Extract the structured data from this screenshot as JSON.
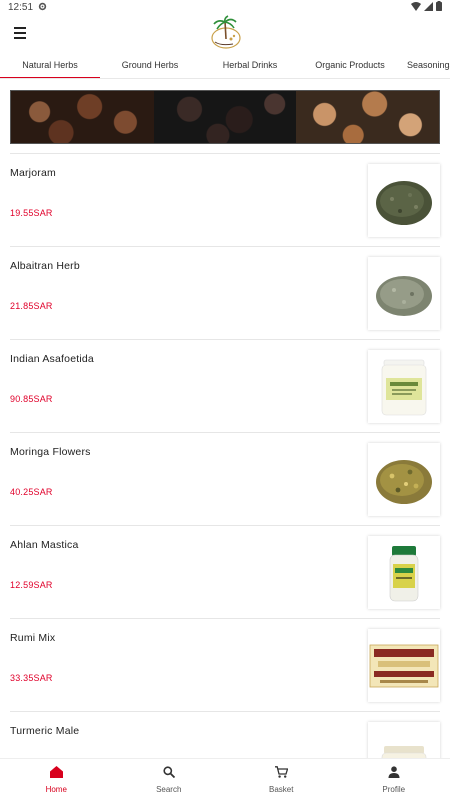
{
  "status": {
    "time": "12:51"
  },
  "tabs": [
    {
      "label": "Natural Herbs"
    },
    {
      "label": "Ground Herbs"
    },
    {
      "label": "Herbal Drinks"
    },
    {
      "label": "Organic Products"
    },
    {
      "label": "Seasonings"
    }
  ],
  "products": [
    {
      "name": "Marjoram",
      "price": "19.55SAR"
    },
    {
      "name": "Albaitran Herb",
      "price": "21.85SAR"
    },
    {
      "name": "Indian Asafoetida",
      "price": "90.85SAR"
    },
    {
      "name": "Moringa Flowers",
      "price": "40.25SAR"
    },
    {
      "name": "Ahlan Mastica",
      "price": "12.59SAR"
    },
    {
      "name": "Rumi Mix",
      "price": "33.35SAR"
    },
    {
      "name": "Turmeric Male",
      "price": ""
    }
  ],
  "nav": {
    "home": "Home",
    "search": "Search",
    "basket": "Basket",
    "profile": "Profile"
  },
  "colors": {
    "accent": "#d8001d",
    "price": "#e0002a"
  }
}
